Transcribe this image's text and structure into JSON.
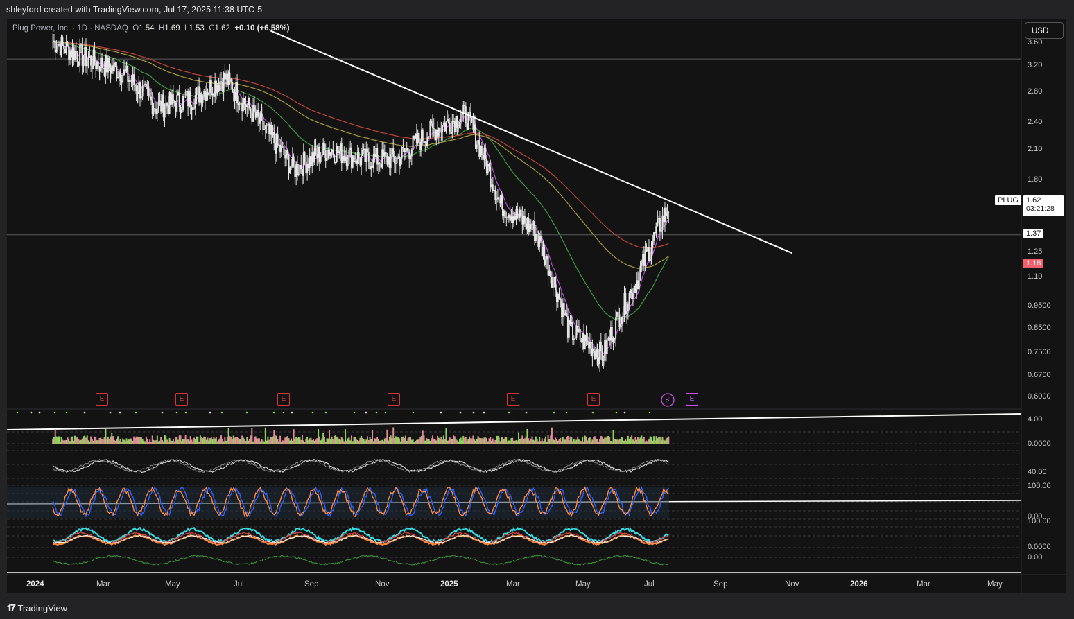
{
  "header": {
    "caption": "shleyford created with TradingView.com, Jul 17, 2025 11:38 UTC-5"
  },
  "legend": {
    "symbol": "Plug Power, Inc. · 1D · NASDAQ",
    "open_label": "O",
    "open": "1.54",
    "high_label": "H",
    "high": "1.69",
    "low_label": "L",
    "low": "1.53",
    "close_label": "C",
    "close": "1.62",
    "change": "+0.10 (+6.58%)"
  },
  "currency": "USD",
  "price_axis": {
    "ticks": [
      "3.60",
      "3.20",
      "2.80",
      "2.40",
      "2.10",
      "1.80",
      "1.25",
      "1.10",
      "0.9500",
      "0.8500",
      "0.7500",
      "0.6700",
      "0.6000"
    ],
    "symbol_tag": "PLUG",
    "last_price": "1.62",
    "countdown": "03:21:28",
    "hline_price": "1.37",
    "red_tag": "1.18"
  },
  "pane_axes": {
    "volume": [
      "4.00",
      "0.0000"
    ],
    "rsi": [
      "40.00"
    ],
    "stoch": [
      "100.00",
      "0.00"
    ],
    "mfi": [
      "100.00",
      "0.0000"
    ],
    "osc": [
      "0.00"
    ]
  },
  "time_axis": {
    "labels": [
      "2024",
      "Mar",
      "May",
      "Jul",
      "Sep",
      "Nov",
      "2025",
      "Mar",
      "May",
      "Jul",
      "Sep",
      "Nov",
      "2026",
      "Mar",
      "May"
    ],
    "bold": [
      "2024",
      "2025",
      "2026"
    ]
  },
  "earnings_marker": "E",
  "footer": {
    "brand": "TradingView"
  },
  "colors": {
    "background": "#131313",
    "frame": "#232325",
    "candle": "#e6e6e6",
    "ema_purple": "#b04fd0",
    "ema_green": "#3f9b3f",
    "ema_olive": "#a89a3a",
    "ema_red": "#c0443c",
    "trendline": "#ffffff",
    "volume_up": "#8fd35a",
    "volume_down": "#e08a9a",
    "stoch_blue": "#2962ff",
    "stoch_orange": "#ff8a3d",
    "mfi_cyan": "#35e0e6",
    "tag_red": "#f0616d"
  },
  "chart_data": {
    "type": "candlestick",
    "symbol": "PLUG",
    "timeframe": "1D",
    "x": [
      "2024-01",
      "2024-02",
      "2024-03",
      "2024-04",
      "2024-05",
      "2024-06",
      "2024-07",
      "2024-08",
      "2024-09",
      "2024-10",
      "2024-11",
      "2024-12",
      "2025-01",
      "2025-02",
      "2025-03",
      "2025-04",
      "2025-05",
      "2025-06",
      "2025-07"
    ],
    "close": [
      3.6,
      3.3,
      3.1,
      2.6,
      2.7,
      3.0,
      2.4,
      1.9,
      2.1,
      2.0,
      2.0,
      2.3,
      2.5,
      1.6,
      1.4,
      0.85,
      0.75,
      1.1,
      1.62
    ],
    "trendline": [
      [
        "2024-07-25",
        3.8
      ],
      [
        "2025-10-30",
        1.25
      ]
    ],
    "horizontal_lines": [
      3.3,
      1.37
    ],
    "price_range": [
      0.58,
      3.8
    ],
    "price_scale": "log",
    "last": {
      "open": 1.54,
      "high": 1.69,
      "low": 1.53,
      "close": 1.62,
      "change": 0.1,
      "change_pct": 6.58
    }
  }
}
